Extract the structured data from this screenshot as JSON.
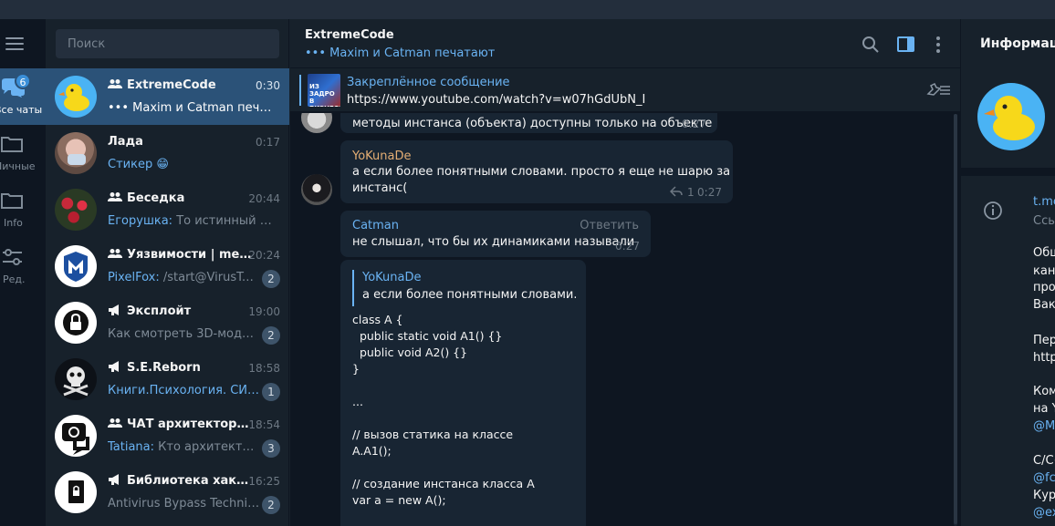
{
  "window": {
    "titlebar": ""
  },
  "rail": {
    "folders": [
      {
        "label": "Все чаты",
        "badge": "6",
        "active": true
      },
      {
        "label": "Личные",
        "active": false
      },
      {
        "label": "Info",
        "active": false
      },
      {
        "label": "Ред.",
        "active": false
      }
    ]
  },
  "chatlist": {
    "search_placeholder": "Поиск",
    "chats": [
      {
        "name": "ExtremeCode",
        "time": "0:30",
        "preview": "••• Maxim и Catman печатают",
        "sender": "",
        "badge": "",
        "icon": "group-icon",
        "active": true
      },
      {
        "name": "Лада",
        "time": "0:17",
        "preview": "Стикер 😁",
        "sender": "",
        "badge": "",
        "icon": "",
        "active": false
      },
      {
        "name": "Беседка",
        "time": "20:44",
        "preview": "То истинный ариец",
        "sender": "Егорушка:",
        "badge": "",
        "icon": "group-icon",
        "active": false
      },
      {
        "name": "Уязвимости | met...",
        "time": "20:24",
        "preview": "/start@VirusTot...",
        "sender": "PixelFox:",
        "badge": "2",
        "icon": "group-icon",
        "active": false
      },
      {
        "name": "Эксплойт",
        "time": "19:00",
        "preview": "Как смотреть 3D-модели...",
        "sender": "",
        "badge": "2",
        "icon": "channel-icon",
        "active": false
      },
      {
        "name": "S.E.Reborn",
        "time": "18:58",
        "preview": "Книги.Психология. СИ..zi...",
        "sender": "",
        "badge": "1",
        "icon": "channel-icon",
        "active": false
      },
      {
        "name": "ЧАТ архитекторов",
        "time": "18:54",
        "preview": "Кто архитектор ...",
        "sender": "Tatiana:",
        "badge": "3",
        "icon": "group-icon",
        "active": false
      },
      {
        "name": "Библиотека хакера",
        "time": "16:25",
        "preview": "Antivirus Bypass Techniqu...",
        "sender": "",
        "badge": "2",
        "icon": "channel-icon",
        "active": false
      }
    ]
  },
  "conversation": {
    "title": "ExtremeCode",
    "status": "••• Maxim и Catman печатают",
    "pinned": {
      "title": "Закреплённое сообщение",
      "text": "https://www.youtube.com/watch?v=w07hGdUbN_I",
      "thumb_text": "ИЗ ЗАДРО В БИЗНЕСМЕ"
    },
    "messages": [
      {
        "author": "",
        "text": "методы инстанса (объекта) доступны только на объекте",
        "time": "0:27"
      },
      {
        "author": "YoKunaDe",
        "author_color": "#e4ae74",
        "text": "а если более понятными словами. просто я еще не шарю за\nинстанс(",
        "time": "0:27",
        "replies": "1"
      },
      {
        "author": "Catman",
        "author_color": "#6ab3f3",
        "reply_action": "Ответить",
        "text": "не слышал, что бы их динамиками называли",
        "time": "0:27"
      },
      {
        "quote_author": "YoKunaDe",
        "quote_text": "а если более понятными словами. п...",
        "code": "class A {\n  public static void A1() {}\n  public void A2() {}\n}\n\n...\n\n// вызов статика на классе\nA.A1();\n\n// создание инстанса класса A\nvar a = new A();"
      }
    ]
  },
  "info": {
    "title": "Информация",
    "lines": [
      {
        "text": "t.me",
        "style": "link"
      },
      {
        "text": "Ссы",
        "style": "muted"
      },
      {
        "text": "Общ",
        "style": ""
      },
      {
        "text": "кана",
        "style": ""
      },
      {
        "text": "про",
        "style": ""
      },
      {
        "text": "Вака",
        "style": ""
      },
      {
        "text": "Пер",
        "style": ""
      },
      {
        "text": "http",
        "style": ""
      },
      {
        "text": "Ком",
        "style": ""
      },
      {
        "text": "на Y",
        "style": ""
      },
      {
        "text": "@M",
        "style": "link"
      },
      {
        "text": "C/C+",
        "style": ""
      },
      {
        "text": "@fcl",
        "style": "link"
      },
      {
        "text": "Курс",
        "style": ""
      },
      {
        "text": "@ex",
        "style": "link"
      }
    ]
  }
}
